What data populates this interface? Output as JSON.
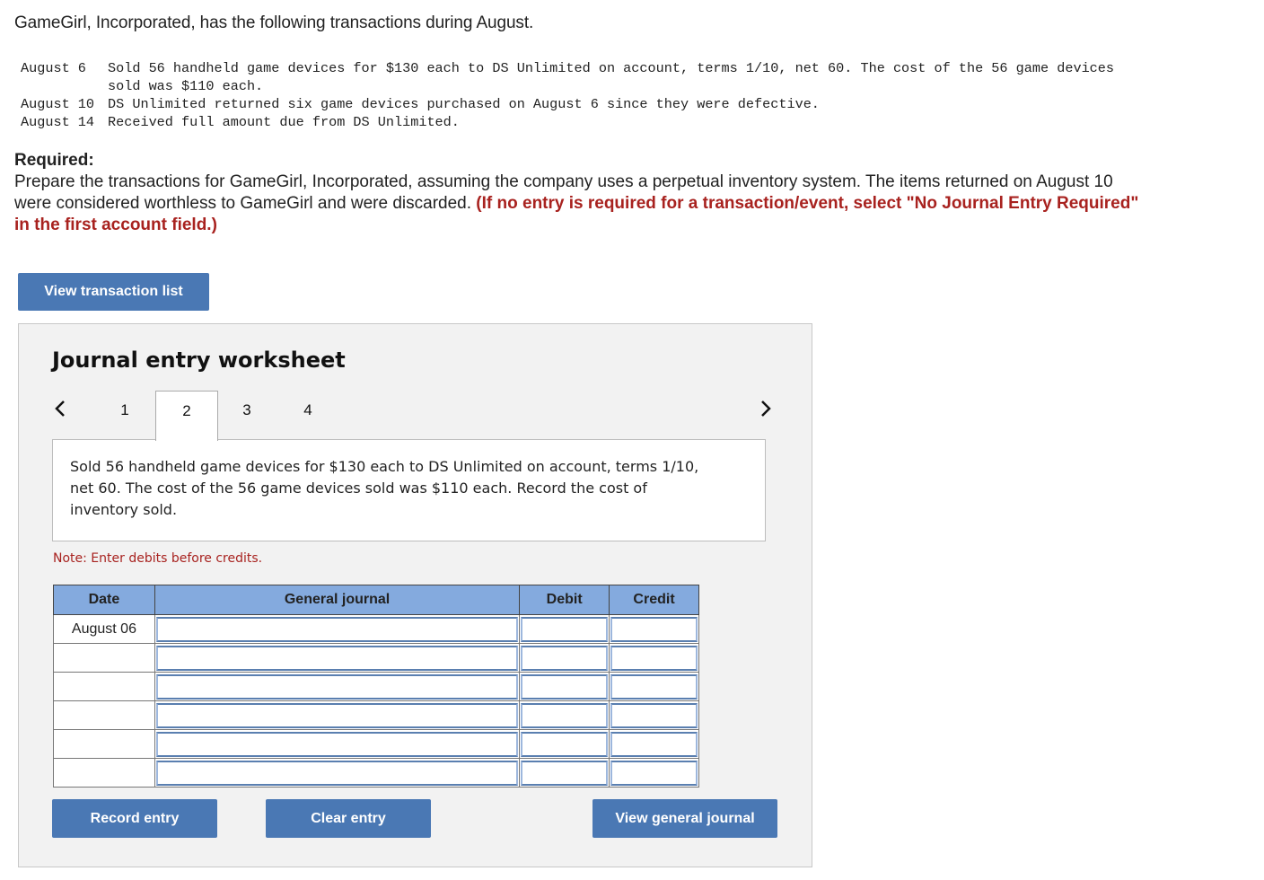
{
  "intro": "GameGirl, Incorporated, has the following transactions during August.",
  "transactions": [
    {
      "date": "August 6 ",
      "description": "Sold 56 handheld game devices for $130 each to DS Unlimited on account, terms 1/10, net 60. The cost of the 56 game devices sold was $110 each."
    },
    {
      "date": "August 10",
      "description": "DS Unlimited returned six game devices purchased on August 6 since they were defective."
    },
    {
      "date": "August 14",
      "description": "Received full amount due from DS Unlimited."
    }
  ],
  "required": {
    "title": "Required:",
    "text": "Prepare the transactions for GameGirl, Incorporated, assuming the company uses a perpetual inventory system. The items returned on August 10 were considered worthless to GameGirl and were discarded. ",
    "instruction": "(If no entry is required for a transaction/event, select \"No Journal Entry Required\" in the first account field.)"
  },
  "buttons": {
    "view_transaction_list": "View transaction list",
    "record_entry": "Record entry",
    "clear_entry": "Clear entry",
    "view_general_journal": "View general journal"
  },
  "worksheet": {
    "title": "Journal entry worksheet",
    "tabs": [
      "1",
      "2",
      "3",
      "4"
    ],
    "active_tab": "2",
    "description": "Sold 56 handheld game devices for $130 each to DS Unlimited on account, terms 1/10, net 60. The cost of the 56 game devices sold was $110 each. Record the cost of inventory sold.",
    "note": "Note: Enter debits before credits.",
    "table": {
      "headers": {
        "date": "Date",
        "journal": "General journal",
        "debit": "Debit",
        "credit": "Credit"
      },
      "rows": [
        {
          "date": "August 06",
          "account": "",
          "debit": "",
          "credit": ""
        },
        {
          "date": "",
          "account": "",
          "debit": "",
          "credit": ""
        },
        {
          "date": "",
          "account": "",
          "debit": "",
          "credit": ""
        },
        {
          "date": "",
          "account": "",
          "debit": "",
          "credit": ""
        },
        {
          "date": "",
          "account": "",
          "debit": "",
          "credit": ""
        },
        {
          "date": "",
          "account": "",
          "debit": "",
          "credit": ""
        }
      ]
    }
  },
  "icons": {
    "prev": "chevron-left-icon",
    "next": "chevron-right-icon",
    "field_marker": "dropdown-marker-icon"
  },
  "colors": {
    "button": "#4a78b4",
    "header": "#84aade",
    "accent_red": "#a8221f",
    "panel": "#f2f2f2"
  }
}
